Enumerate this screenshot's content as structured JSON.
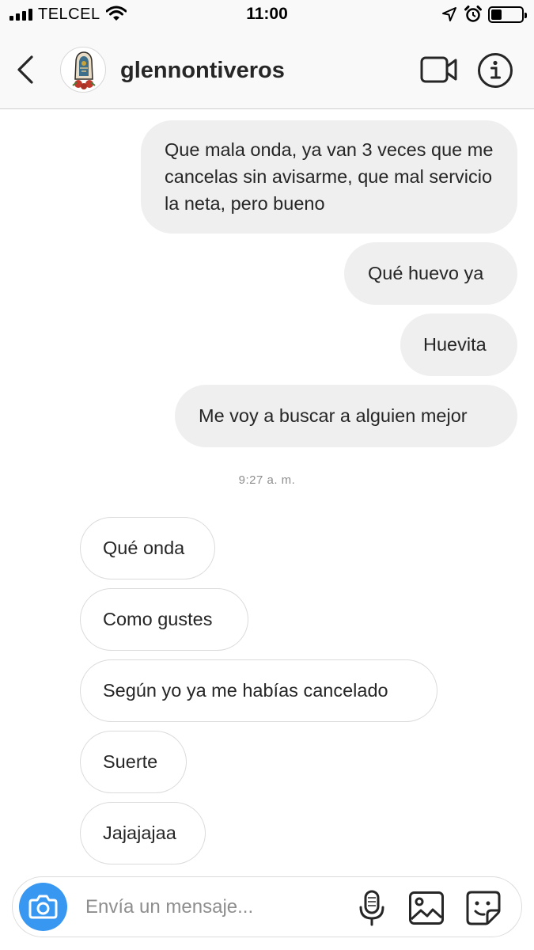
{
  "status_bar": {
    "carrier": "TELCEL",
    "time": "11:00",
    "battery_level": 0.35,
    "icons": [
      "signal-icon",
      "wifi-icon",
      "location-arrow-icon",
      "alarm-icon",
      "battery-icon"
    ]
  },
  "header": {
    "username": "glennontiveros",
    "icons": [
      "back-chevron-icon",
      "avatar",
      "video-call-icon",
      "info-icon"
    ]
  },
  "messages": {
    "sent": [
      "Que mala onda, ya van 3 veces que me cancelas sin avisarme, que mal servicio la neta, pero bueno",
      "Qué huevo ya",
      "Huevita",
      "Me voy a buscar a alguien mejor"
    ],
    "timestamp": "9:27 a. m.",
    "received": [
      "Qué onda",
      "Como gustes",
      "Según yo ya me habías cancelado",
      "Suerte",
      "Jajajajaa"
    ]
  },
  "composer": {
    "placeholder": "Envía un mensaje...",
    "value": "",
    "icons": [
      "camera-icon",
      "microphone-icon",
      "gallery-icon",
      "sticker-icon"
    ]
  },
  "colors": {
    "accent": "#3897f0",
    "sent_bubble": "#efefef",
    "received_border": "#dbdbdb",
    "text": "#262626",
    "muted": "#8e8e8e"
  }
}
